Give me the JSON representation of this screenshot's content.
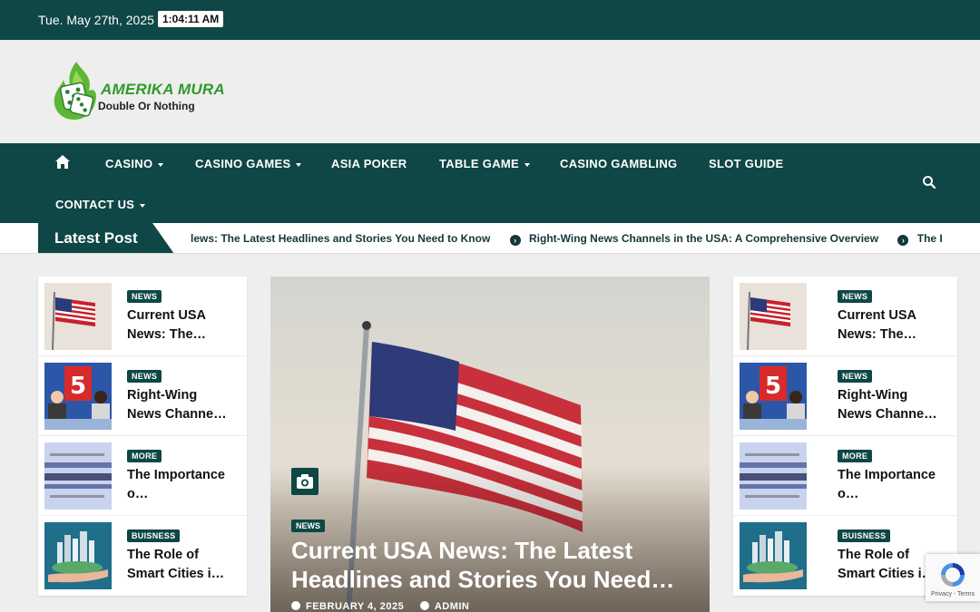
{
  "topbar": {
    "date": "Tue. May 27th, 2025",
    "time": "1:04:11 AM"
  },
  "brand": {
    "name": "AMERIKA MURA",
    "tagline": "Double Or Nothing"
  },
  "nav": {
    "home_icon": "home-icon",
    "items": [
      {
        "label": "CASINO",
        "dropdown": true
      },
      {
        "label": "CASINO GAMES",
        "dropdown": true
      },
      {
        "label": "ASIA POKER",
        "dropdown": false
      },
      {
        "label": "TABLE GAME",
        "dropdown": true
      },
      {
        "label": "CASINO GAMBLING",
        "dropdown": false
      },
      {
        "label": "SLOT GUIDE",
        "dropdown": false
      },
      {
        "label": "CONTACT US",
        "dropdown": true
      }
    ],
    "search_icon": "search-icon"
  },
  "ticker": {
    "label": "Latest Post",
    "items": [
      "lews: The Latest Headlines and Stories You Need to Know",
      "Right-Wing News Channels in the USA: A Comprehensive Overview",
      "The Imp"
    ]
  },
  "side_posts": [
    {
      "category": "NEWS",
      "title": "Current USA News: The…",
      "thumb": "flag"
    },
    {
      "category": "NEWS",
      "title": "Right-Wing News Channe…",
      "thumb": "news"
    },
    {
      "category": "MORE",
      "title": "The Importance o…",
      "thumb": "fact"
    },
    {
      "category": "BUISNESS",
      "title": "The Role of Smart Cities i…",
      "thumb": "city"
    }
  ],
  "hero": {
    "category": "NEWS",
    "title": "Current USA News: The Latest Headlines and Stories You Need…",
    "date": "FEBRUARY 4, 2025",
    "author": "ADMIN"
  },
  "recaptcha": {
    "terms": "Privacy - Terms"
  },
  "colors": {
    "primary": "#0e4746",
    "brand_green": "#2f9b2a",
    "background": "#eeeeee"
  }
}
